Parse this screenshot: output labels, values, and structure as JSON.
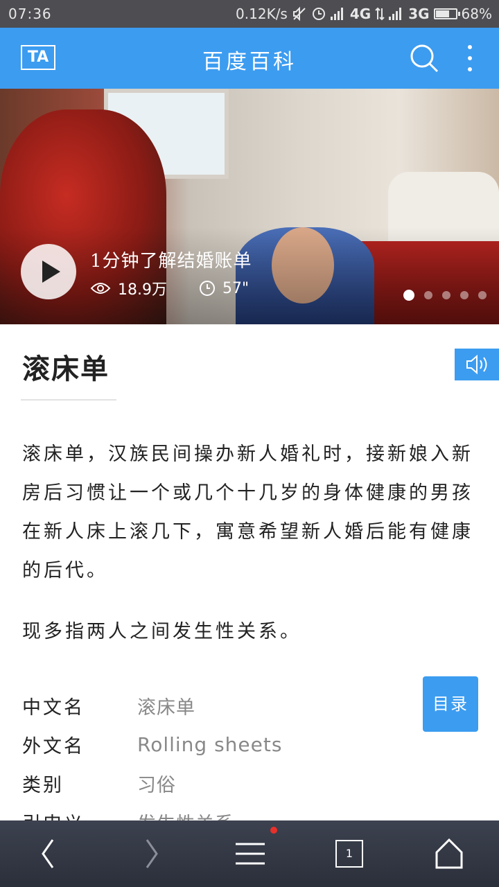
{
  "status_bar": {
    "time": "07:36",
    "net_speed": "0.12K/s",
    "network1": "4G",
    "network2": "3G",
    "battery": "68%",
    "battery_level": 0.68
  },
  "app_bar": {
    "logo_text": "TA",
    "title": "百度百科",
    "icons": [
      "search-icon",
      "more-icon"
    ]
  },
  "hero": {
    "video_title": "1分钟了解结婚账单",
    "views": "18.9万",
    "duration": "57\"",
    "slide_count": 5,
    "active_slide": 0
  },
  "article": {
    "title": "滚床单",
    "paragraphs": [
      "滚床单，汉族民间操办新人婚礼时，接新娘入新房后习惯让一个或几个十几岁的身体健康的男孩在新人床上滚几下，寓意希望新人婚后能有健康的后代。",
      "现多指两人之间发生性关系。"
    ],
    "info": [
      {
        "key": "中文名",
        "value": "滚床单"
      },
      {
        "key": "外文名",
        "value": "Rolling sheets"
      },
      {
        "key": "类别",
        "value": "习俗"
      },
      {
        "key": "引申义",
        "value": "发生性关系"
      }
    ],
    "toc_label": "目录"
  },
  "bottom_bar": {
    "tab_count": "1",
    "icons": [
      "back-icon",
      "forward-icon",
      "menu-icon",
      "tabs-icon",
      "home-icon"
    ]
  },
  "colors": {
    "accent": "#3c9cf0",
    "status_bar": "#4d4d52",
    "bottom_bar": "#2f333d"
  }
}
